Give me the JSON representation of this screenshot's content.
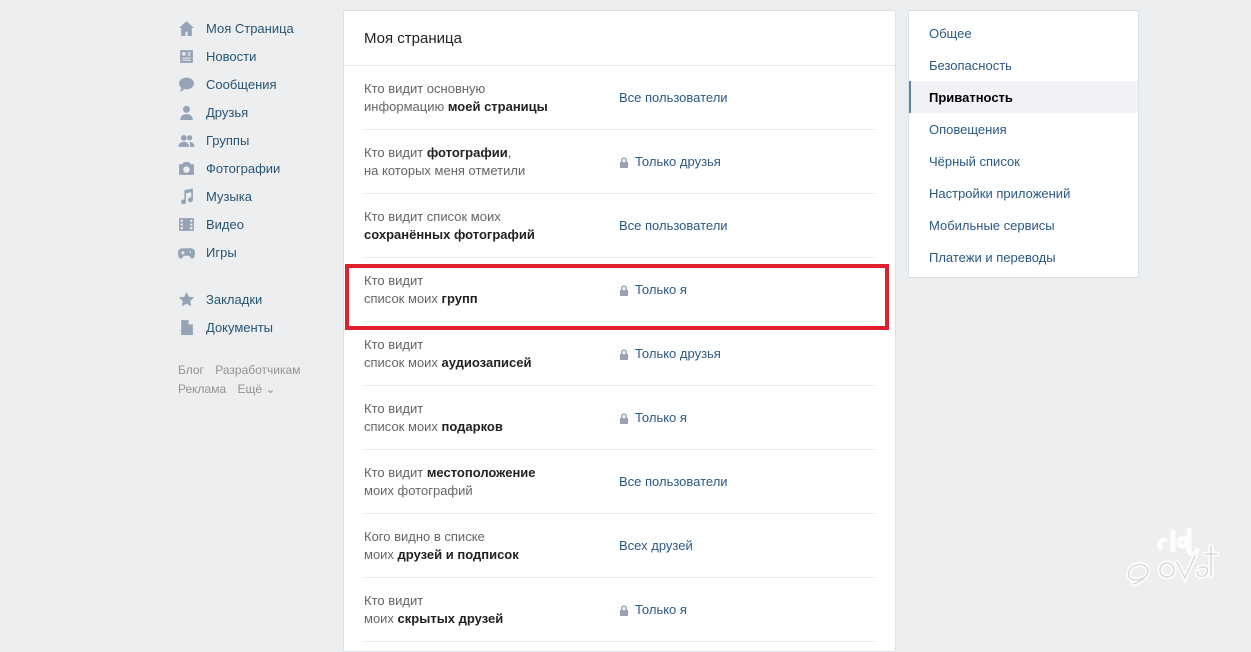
{
  "left_nav": {
    "items": [
      {
        "label": "Моя Страница",
        "icon": "home-icon"
      },
      {
        "label": "Новости",
        "icon": "news-icon"
      },
      {
        "label": "Сообщения",
        "icon": "messages-icon"
      },
      {
        "label": "Друзья",
        "icon": "friends-icon"
      },
      {
        "label": "Группы",
        "icon": "groups-icon"
      },
      {
        "label": "Фотографии",
        "icon": "camera-icon"
      },
      {
        "label": "Музыка",
        "icon": "music-icon"
      },
      {
        "label": "Видео",
        "icon": "video-icon"
      },
      {
        "label": "Игры",
        "icon": "gamepad-icon"
      }
    ],
    "secondary": [
      {
        "label": "Закладки",
        "icon": "star-icon"
      },
      {
        "label": "Документы",
        "icon": "document-icon"
      }
    ],
    "footer": {
      "blog": "Блог",
      "developers": "Разработчикам",
      "ads": "Реклама",
      "more": "Ещё ⌄"
    }
  },
  "main": {
    "title": "Моя страница",
    "rows": [
      {
        "q1": "Кто видит основную",
        "q2_plain": "информацию ",
        "q2_bold": "моей страницы",
        "value": "Все пользователи",
        "locked": false
      },
      {
        "q1_plain": "Кто видит ",
        "q1_bold": "фотографии",
        "q1_tail": ",",
        "q2": "на которых меня отметили",
        "value": "Только друзья",
        "locked": true
      },
      {
        "q1": "Кто видит список моих",
        "q2_bold": "сохранённых фотографий",
        "value": "Все пользователи",
        "locked": false
      },
      {
        "q1": "Кто видит",
        "q2_plain": "список моих ",
        "q2_bold": "групп",
        "value": "Только я",
        "locked": true
      },
      {
        "q1": "Кто видит",
        "q2_plain": "список моих ",
        "q2_bold": "аудиозаписей",
        "value": "Только друзья",
        "locked": true
      },
      {
        "q1": "Кто видит",
        "q2_plain": "список моих ",
        "q2_bold": "подарков",
        "value": "Только я",
        "locked": true
      },
      {
        "q1_plain": "Кто видит ",
        "q1_bold": "местоположение",
        "q2": "моих фотографий",
        "value": "Все пользователи",
        "locked": false
      },
      {
        "q1": "Кого видно в списке",
        "q2_plain": "моих ",
        "q2_bold": "друзей и подписок",
        "value": "Всех друзей",
        "locked": false
      },
      {
        "q1": "Кто видит",
        "q2_plain": "моих ",
        "q2_bold": "скрытых друзей",
        "value": "Только я",
        "locked": true
      }
    ]
  },
  "right_menu": {
    "items": [
      "Общее",
      "Безопасность",
      "Приватность",
      "Оповещения",
      "Чёрный список",
      "Настройки приложений",
      "Мобильные сервисы",
      "Платежи и переводы"
    ],
    "active": "Приватность"
  },
  "colors": {
    "link": "#2a5885",
    "highlight": "#e0202c",
    "background": "#edeef0"
  }
}
